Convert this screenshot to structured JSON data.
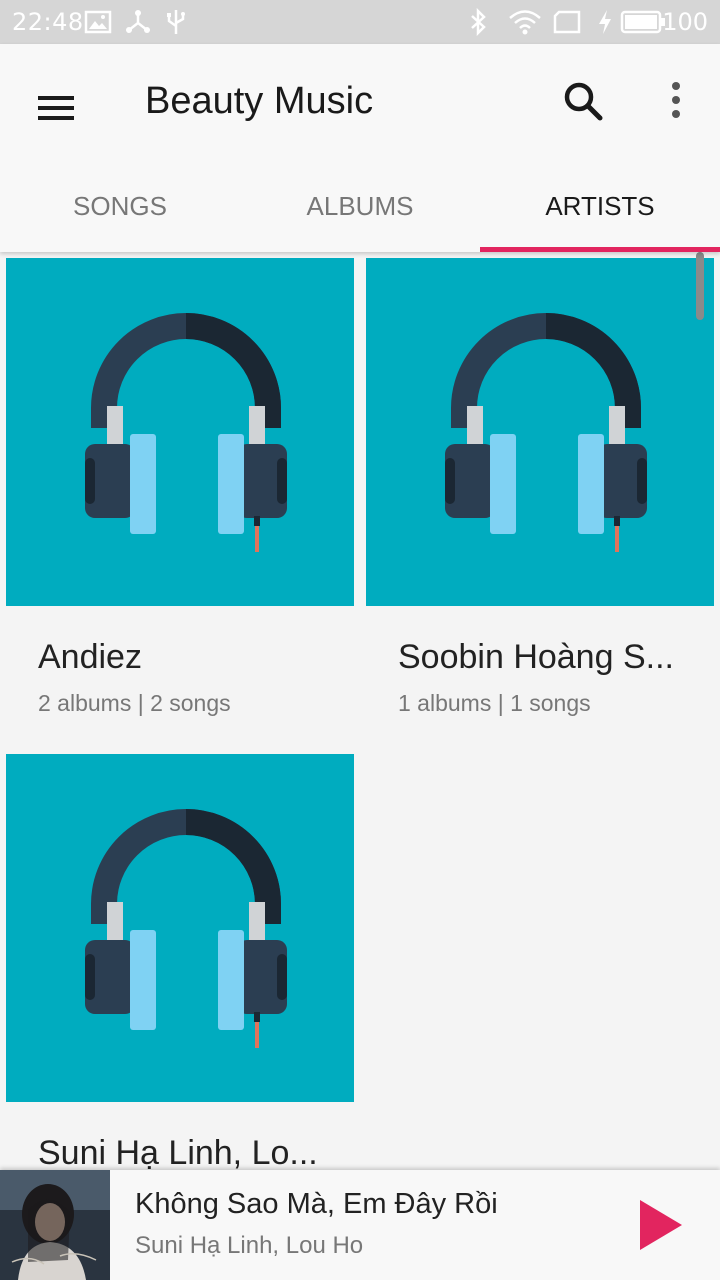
{
  "status_bar": {
    "time": "22:48",
    "battery_level": "100",
    "icons": [
      "image-icon",
      "share-icon",
      "usb-icon",
      "bluetooth-icon",
      "wifi-icon",
      "screen-icon",
      "charging-icon",
      "battery-icon"
    ]
  },
  "app_bar": {
    "title": "Beauty Music",
    "icons": {
      "menu": "hamburger-menu-icon",
      "search": "search-icon",
      "more": "more-vertical-icon"
    }
  },
  "tabs": [
    {
      "label": "SONGS",
      "active": false
    },
    {
      "label": "ALBUMS",
      "active": false
    },
    {
      "label": "ARTISTS",
      "active": true
    }
  ],
  "artists": [
    {
      "name": "Andiez",
      "summary": "2 albums | 2 songs",
      "art_icon": "headphones-icon"
    },
    {
      "name": "Soobin Hoàng S...",
      "summary": "1 albums | 1 songs",
      "art_icon": "headphones-icon"
    },
    {
      "name": "Suni Hạ Linh, Lo...",
      "summary": "",
      "art_icon": "headphones-icon"
    }
  ],
  "now_playing": {
    "title": "Không Sao Mà, Em Đây Rồi",
    "artist": "Suni Hạ Linh, Lou Ho",
    "play_icon": "play-icon"
  },
  "colors": {
    "accent": "#e2255f",
    "art_background": "#00acbf",
    "headphone_dark": "#2b3e52",
    "headphone_light": "#7fd2f3",
    "status_bar": "#d6d6d6"
  }
}
